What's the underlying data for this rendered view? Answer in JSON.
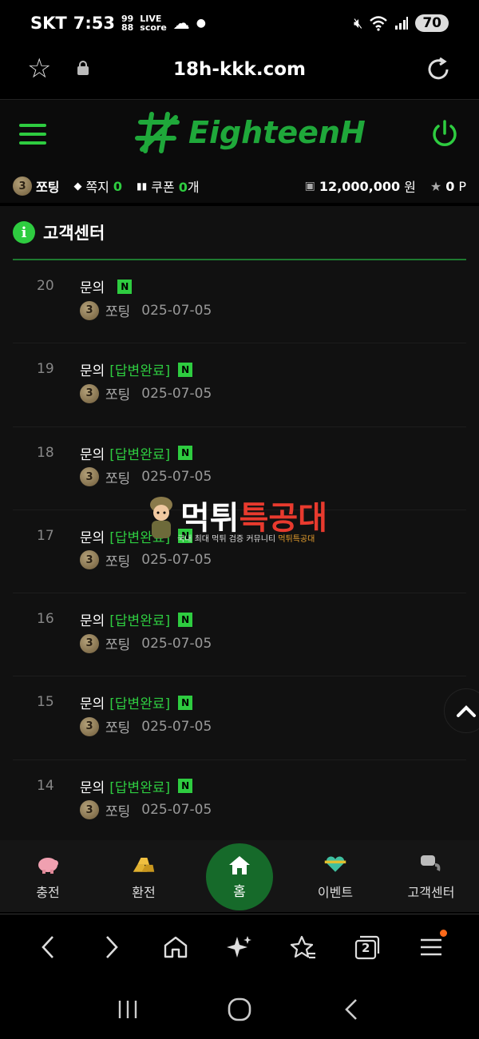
{
  "status_bar": {
    "carrier": "SKT",
    "time": "7:53",
    "score_label": "LIVE\nscore",
    "battery": "70"
  },
  "url_bar": {
    "url": "18h-kkk.com"
  },
  "header": {
    "logo_text": "EighteenH"
  },
  "info_bar": {
    "level": "3",
    "nickname": "쪼팅",
    "note_label": "쪽지",
    "note_count": "0",
    "coupon_label": "쿠폰",
    "coupon_count": "0",
    "coupon_unit": "개",
    "money": "12,000,000",
    "money_unit": "원",
    "points": "0",
    "points_unit": "P"
  },
  "section": {
    "title": "고객센터"
  },
  "posts": [
    {
      "num": "20",
      "title": "문의",
      "status": "",
      "new": "N",
      "level": "3",
      "user": "쪼팅",
      "date": "025-07-05"
    },
    {
      "num": "19",
      "title": "문의",
      "status": "[답변완료]",
      "new": "N",
      "level": "3",
      "user": "쪼팅",
      "date": "025-07-05"
    },
    {
      "num": "18",
      "title": "문의",
      "status": "[답변완료]",
      "new": "N",
      "level": "3",
      "user": "쪼팅",
      "date": "025-07-05"
    },
    {
      "num": "17",
      "title": "문의",
      "status": "[답변완료]",
      "new": "N",
      "level": "3",
      "user": "쪼팅",
      "date": "025-07-05"
    },
    {
      "num": "16",
      "title": "문의",
      "status": "[답변완료]",
      "new": "N",
      "level": "3",
      "user": "쪼팅",
      "date": "025-07-05"
    },
    {
      "num": "15",
      "title": "문의",
      "status": "[답변완료]",
      "new": "N",
      "level": "3",
      "user": "쪼팅",
      "date": "025-07-05"
    },
    {
      "num": "14",
      "title": "문의",
      "status": "[답변완료]",
      "new": "N",
      "level": "3",
      "user": "쪼팅",
      "date": "025-07-05"
    }
  ],
  "watermark": {
    "main_white": "먹튀",
    "main_red": "특공대",
    "sub_white": "국내 최대 먹튀 검증 커뮤니티",
    "sub_red": "먹튀특공대"
  },
  "site_nav": {
    "charge": "충전",
    "exchange": "환전",
    "home": "홈",
    "event": "이벤트",
    "support": "고객센터"
  },
  "browser_bar": {
    "tabs_count": "2"
  }
}
